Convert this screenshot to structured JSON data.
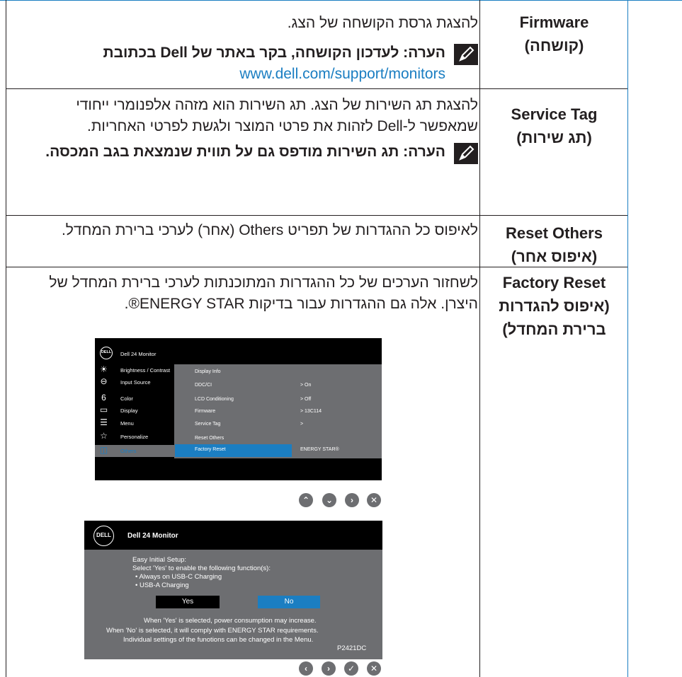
{
  "rows": [
    {
      "name": "Firmware",
      "name_he": "(קושחה)",
      "desc": "להצגת גרסת הקושחה של הצג.",
      "note": "הערה: לעדכון הקושחה, בקר באתר של Dell בכתובת",
      "note_link": "www.dell.com/support/monitors"
    },
    {
      "name": "Service Tag",
      "name_he": "(תג שירות)",
      "desc": "להצגת תג השירות של הצג. תג השירות הוא מזהה אלפנומרי ייחודי שמאפשר ל-Dell לזהות את פרטי המוצר ולגשת לפרטי האחריות.",
      "note": "הערה: תג השירות מודפס גם על תווית שנמצאת בגב המכסה."
    },
    {
      "name": "Reset Others",
      "name_he": "(איפוס אחר)",
      "desc": "לאיפוס כל ההגדרות של תפריט Others (אחר) לערכי ברירת המחדל."
    },
    {
      "name": "Factory Reset",
      "name_he": "(איפוס להגדרות ברירת המחדל)",
      "desc": "לשחזור הערכים של כל ההגדרות המתוכנתות לערכי ברירת המחדל של היצרן. אלה גם ההגדרות עבור בדיקות ENERGY STAR®."
    }
  ],
  "osd": {
    "logo": "DELL",
    "title": "Dell 24 Monitor",
    "menu": [
      {
        "label": "Brightness / Contrast",
        "icon": "sun-icon"
      },
      {
        "label": "Input Source",
        "icon": "input-source-icon"
      },
      {
        "label": "Color",
        "icon": "color-icon"
      },
      {
        "label": "Display",
        "icon": "display-icon"
      },
      {
        "label": "Menu",
        "icon": "menu-icon"
      },
      {
        "label": "Personalize",
        "icon": "star-icon"
      },
      {
        "label": "Others",
        "icon": "others-icon"
      }
    ],
    "submenu": [
      "Display Info",
      "DDC/CI",
      "LCD Conditioning",
      "Firmware",
      "Service Tag",
      "Reset Others",
      "Factory Reset"
    ],
    "values": [
      "> On",
      "> Off",
      "> 13C114",
      ">",
      "ENERGY STAR®"
    ]
  },
  "osd2": {
    "logo": "DELL",
    "title": "Dell 24 Monitor",
    "lines": [
      "Easy Initial Setup:",
      "Select 'Yes' to enable the following function(s):",
      "• Always on USB-C Charging",
      "• USB-A Charging"
    ],
    "yes": "Yes",
    "no": "No",
    "footer": [
      "When 'Yes' is selected, power consumption may increase.",
      "When 'No' is selected, it will comply with ENERGY STAR requirements.",
      "Individual settings of the funotions can be changed in the Menu."
    ],
    "model": "P2421DC"
  },
  "buttons1": [
    "up-icon",
    "down-icon",
    "right-icon",
    "close-icon"
  ],
  "buttons2": [
    "left-icon",
    "right-icon",
    "check-icon",
    "close-icon"
  ],
  "colors": {
    "accent": "#1b7ec2",
    "osd_gray": "#6d6e71",
    "text": "#231f20"
  }
}
